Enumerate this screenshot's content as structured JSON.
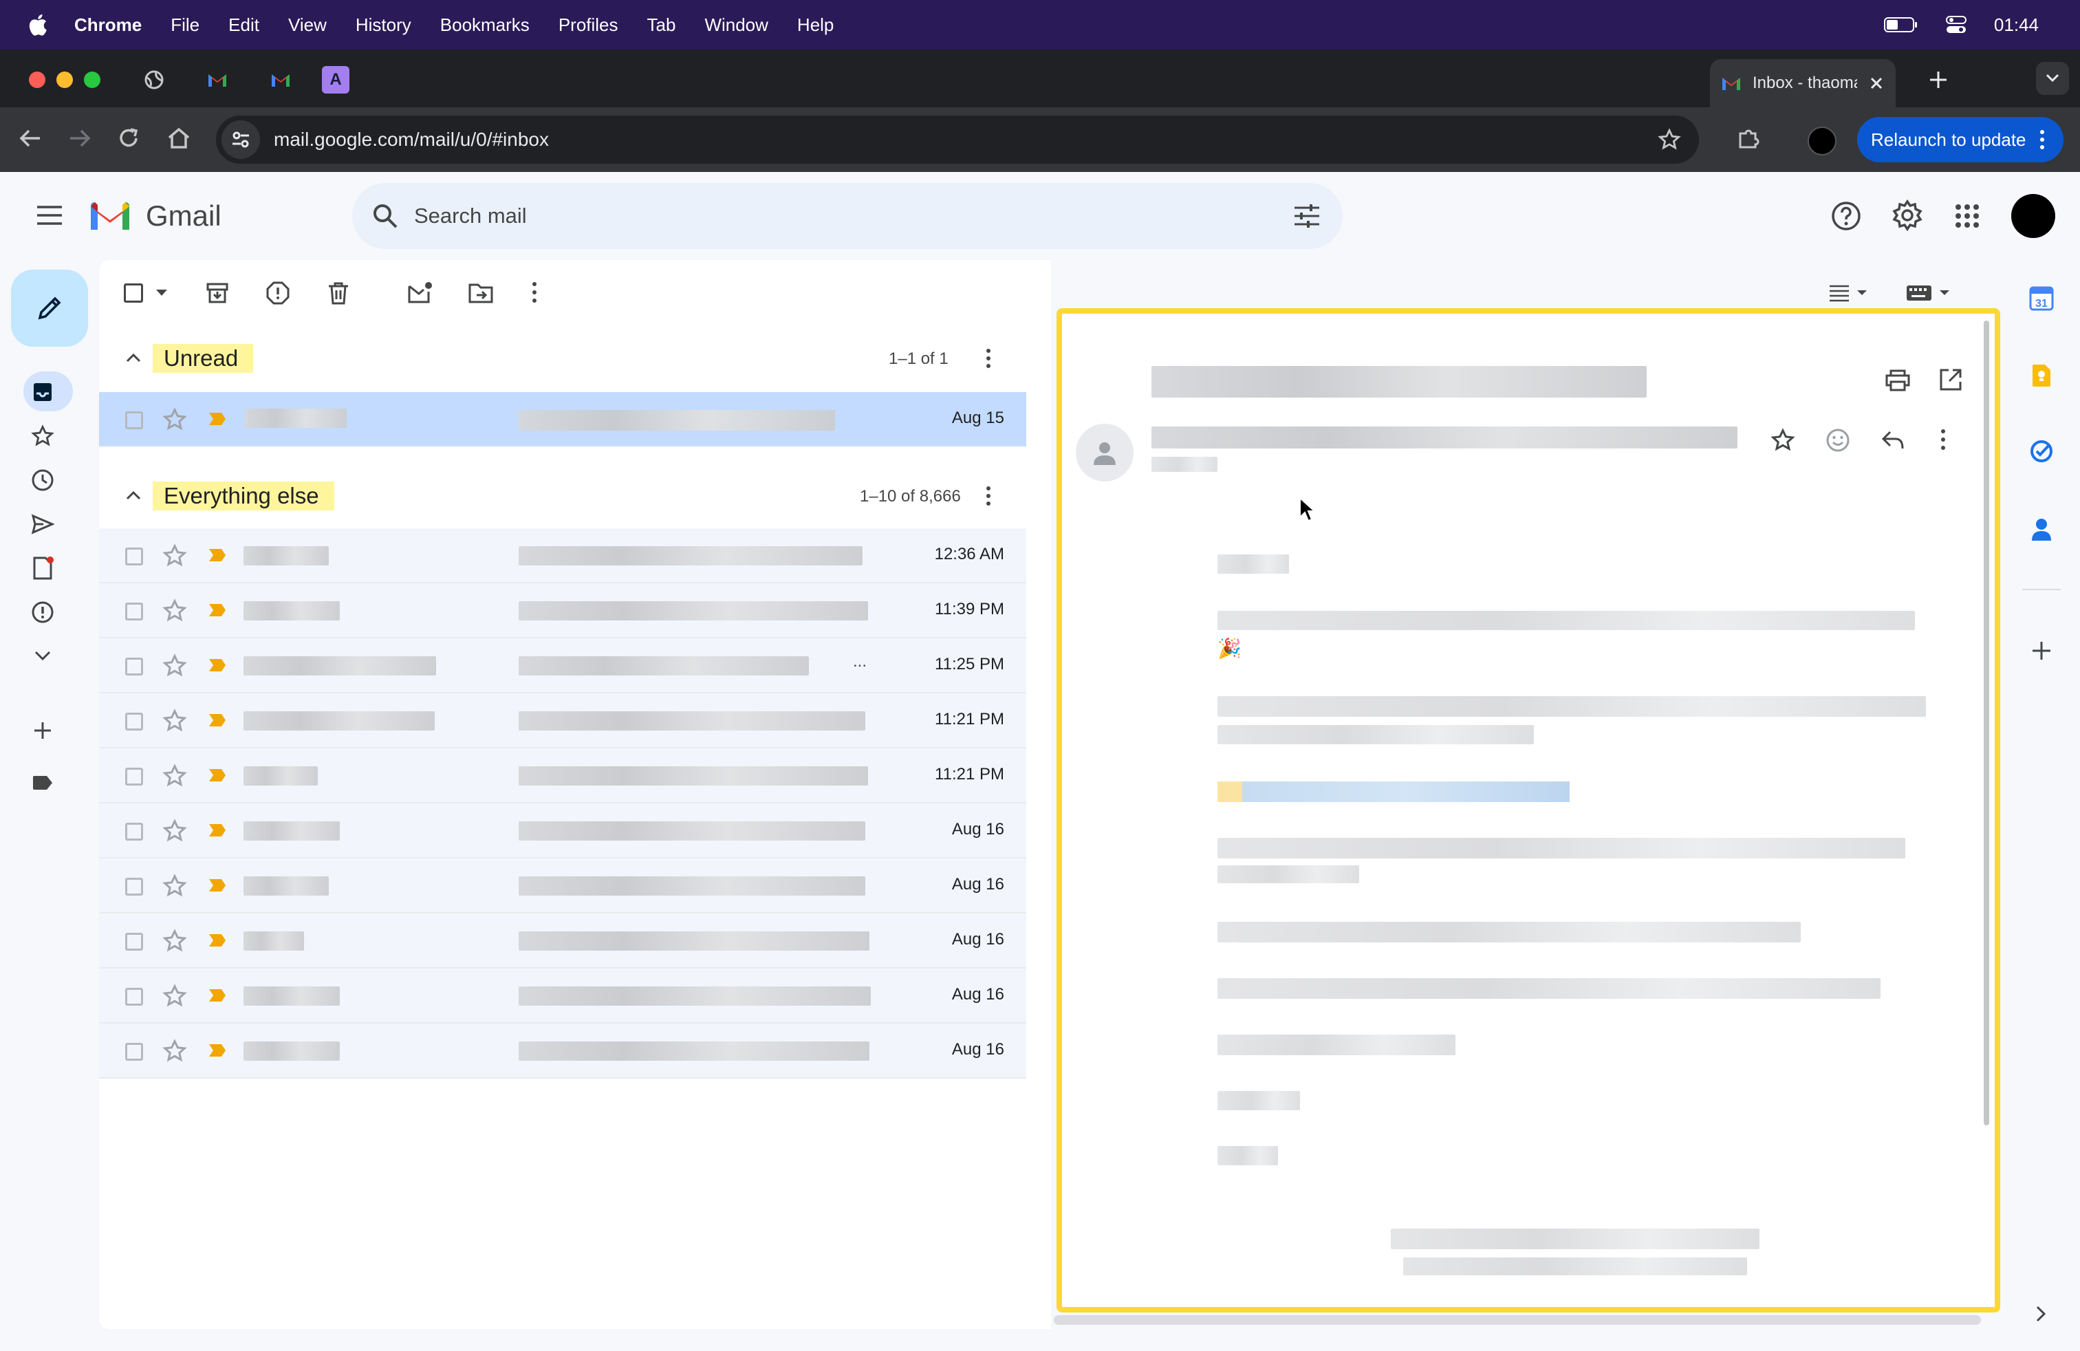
{
  "menubar": {
    "app": "Chrome",
    "items": [
      "File",
      "Edit",
      "View",
      "History",
      "Bookmarks",
      "Profiles",
      "Tab",
      "Window",
      "Help"
    ],
    "time": "01:44"
  },
  "browser": {
    "active_tab_title": "Inbox - thaoma",
    "pinned_tab_letter": "A",
    "url": "mail.google.com/mail/u/0/#inbox",
    "relaunch_label": "Relaunch to update"
  },
  "gmail": {
    "logo_text": "Gmail",
    "search_placeholder": "Search mail"
  },
  "sections": {
    "unread": {
      "title": "Unread",
      "count": "1–1 of 1"
    },
    "everything_else": {
      "title": "Everything else",
      "count": "1–10 of 8,666"
    }
  },
  "unread_rows": [
    {
      "date": "Aug 15"
    }
  ],
  "rows": [
    {
      "date": "12:36 AM"
    },
    {
      "date": "11:39 PM"
    },
    {
      "date": "11:25 PM",
      "ellipsis": "..."
    },
    {
      "date": "11:21 PM"
    },
    {
      "date": "11:21 PM"
    },
    {
      "date": "Aug 16"
    },
    {
      "date": "Aug 16"
    },
    {
      "date": "Aug 16"
    },
    {
      "date": "Aug 16"
    },
    {
      "date": "Aug 16"
    }
  ],
  "reading_pane": {
    "emoji": "🎉"
  },
  "side_calendar_day": "31",
  "colors": {
    "menubar": "#2a1a57",
    "highlight": "#fff59d",
    "selected_row": "#c2dbff",
    "compose": "#c2e7ff",
    "reading_border": "#fdd835",
    "relaunch": "#0b57d0"
  }
}
